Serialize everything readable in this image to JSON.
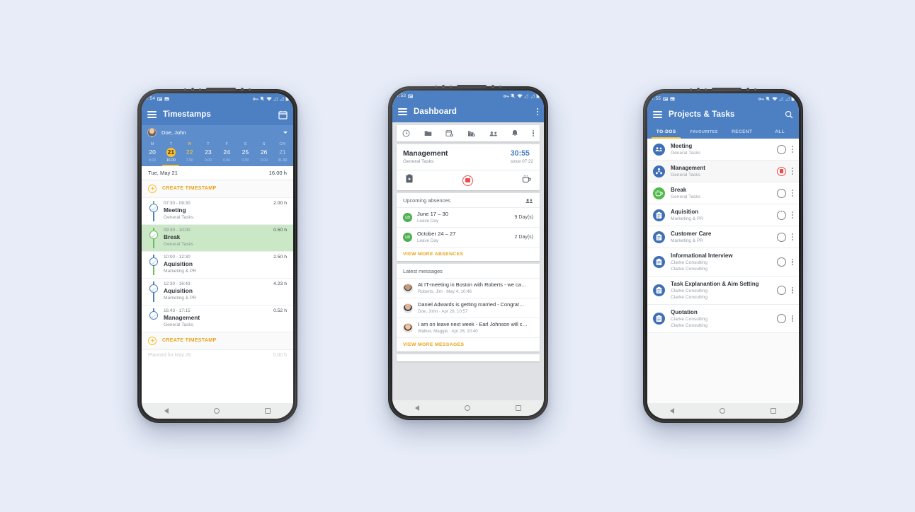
{
  "background_color": "#e7ecf8",
  "accent": {
    "blue": "#4d80c2",
    "amber": "#fbc02d",
    "green": "#52b94b",
    "red": "#ef4b4b"
  },
  "phone1": {
    "statusbar": {
      "time": "7:54",
      "icons": [
        "sim-icon",
        "photo-icon",
        "key-icon",
        "bell-off-icon",
        "wifi-icon",
        "signal-icon",
        "signal-icon",
        "battery-icon"
      ]
    },
    "appbar": {
      "menu_icon": "hamburger-icon",
      "title": "Timestamps",
      "action_icon": "calendar-icon"
    },
    "user": {
      "name": "Doe, John",
      "avatar": "user-avatar",
      "caret": "chevron-down-icon"
    },
    "week": {
      "dows": [
        "M",
        "T",
        "W",
        "T",
        "F",
        "S",
        "S",
        "CW"
      ],
      "days": [
        "20",
        "21",
        "22",
        "23",
        "24",
        "25",
        "26",
        "21"
      ],
      "hours": [
        "8.00",
        "16.00",
        "7.90",
        "0.00",
        "0.00",
        "0.00",
        "0.00",
        "31.90"
      ],
      "selected_index": 1,
      "today_index": 2
    },
    "day_summary": {
      "label": "Tue, May 21",
      "hours": "16.00 h"
    },
    "create_top": "CREATE TIMESTAMP",
    "create_bottom": "CREATE TIMESTAMP",
    "planned": {
      "label": "Planned for May 28",
      "hours": "0.00 h"
    },
    "timestamps": [
      {
        "time": "07:30 - 09:30",
        "duration": "2.00 h",
        "title": "Meeting",
        "project": "General Tasks",
        "kind": "work"
      },
      {
        "time": "09:30 - 10:00",
        "duration": "0.50 h",
        "title": "Break",
        "project": "General Tasks",
        "kind": "break"
      },
      {
        "time": "10:00 - 12:30",
        "duration": "2.50 h",
        "title": "Aquisition",
        "project": "Marketing & PR",
        "kind": "work"
      },
      {
        "time": "12:30 - 16:43",
        "duration": "4.23 h",
        "title": "Aquisition",
        "project": "Marketing & PR",
        "kind": "work"
      },
      {
        "time": "16:43 - 17:15",
        "duration": "0.52 h",
        "title": "Management",
        "project": "General Tasks",
        "kind": "work"
      }
    ]
  },
  "phone2": {
    "statusbar": {
      "time": "7:53",
      "icons": [
        "sim-icon",
        "key-icon",
        "bell-off-icon",
        "wifi-icon",
        "signal-icon",
        "signal-icon",
        "battery-icon"
      ]
    },
    "appbar": {
      "menu_icon": "hamburger-icon",
      "title": "Dashboard",
      "action_icon": "overflow-icon"
    },
    "quick_icons": [
      "clock-icon",
      "folder-icon",
      "calendar-add-icon",
      "building-add-icon",
      "people-icon",
      "bell-icon",
      "overflow-icon"
    ],
    "running": {
      "title": "Management",
      "project": "General Tasks",
      "timer": "30:55",
      "since": "since 07:22",
      "actions": [
        "clipboard-play-icon",
        "stop-record-icon",
        "coffee-break-icon"
      ]
    },
    "absences": {
      "heading": "Upcoming absences",
      "heading_icon": "people-icon",
      "items": [
        {
          "badge": "LD",
          "range": "June 17 – 30",
          "type": "Leave Day",
          "days": "9 Day(s)"
        },
        {
          "badge": "LD",
          "range": "October 24 – 27",
          "type": "Leave Day",
          "days": "2 Day(s)"
        }
      ],
      "more": "VIEW MORE ABSENCES"
    },
    "messages": {
      "heading": "Latest messages",
      "items": [
        {
          "text": "At IT-meeting in Boston with Roberts - we ca…",
          "meta": "Roberts, Jim · May 4, 10:46"
        },
        {
          "text": "Daniel Adwards is getting married - Congrat…",
          "meta": "Doe, John · Apr 28, 10:57"
        },
        {
          "text": "I am on leave next week  - Earl Johnson will c…",
          "meta": "Walker, Maggie · Apr 28, 10:40"
        }
      ],
      "more": "VIEW MORE MESSAGES"
    }
  },
  "phone3": {
    "statusbar": {
      "time": "7:55",
      "icons": [
        "sim-icon",
        "photo-icon",
        "key-icon",
        "bell-off-icon",
        "wifi-icon",
        "signal-icon",
        "signal-icon",
        "battery-icon"
      ]
    },
    "appbar": {
      "menu_icon": "hamburger-icon",
      "title": "Projects & Tasks",
      "action_icon": "search-icon"
    },
    "tabs": [
      {
        "label": "TO-DOS",
        "active": true
      },
      {
        "label": "FAVOURITES",
        "active": false
      },
      {
        "label": "RECENT",
        "active": false
      },
      {
        "label": "ALL",
        "active": false
      }
    ],
    "tasks": [
      {
        "title": "Meeting",
        "lines": [
          "General Tasks"
        ],
        "icon": "people-icon",
        "icon_color": "blue",
        "action": "play"
      },
      {
        "title": "Management",
        "lines": [
          "General Tasks"
        ],
        "icon": "person-network-icon",
        "icon_color": "blue",
        "action": "stop"
      },
      {
        "title": "Break",
        "lines": [
          "General Tasks"
        ],
        "icon": "coffee-icon",
        "icon_color": "green",
        "action": "play"
      },
      {
        "title": "Aquisition",
        "lines": [
          "Marketing & PR"
        ],
        "icon": "clipboard-icon",
        "icon_color": "blue",
        "action": "play"
      },
      {
        "title": "Customer Care",
        "lines": [
          "Marketing & PR"
        ],
        "icon": "clipboard-icon",
        "icon_color": "blue",
        "action": "play"
      },
      {
        "title": "Informational Interview",
        "lines": [
          "Clarke Consulting",
          "Clarke Consulting"
        ],
        "icon": "clipboard-icon",
        "icon_color": "blue",
        "action": "play"
      },
      {
        "title": "Task Explanantion & Aim Setting",
        "lines": [
          "Clarke Consulting",
          "Clarke Consulting"
        ],
        "icon": "clipboard-icon",
        "icon_color": "blue",
        "action": "play"
      },
      {
        "title": "Quotation",
        "lines": [
          "Clarke Consulting",
          "Clarke Consulting"
        ],
        "icon": "clipboard-icon",
        "icon_color": "blue",
        "action": "play"
      }
    ]
  },
  "navbar": {
    "back": "back-triangle-icon",
    "home": "home-circle-icon",
    "recents": "recents-square-icon"
  }
}
